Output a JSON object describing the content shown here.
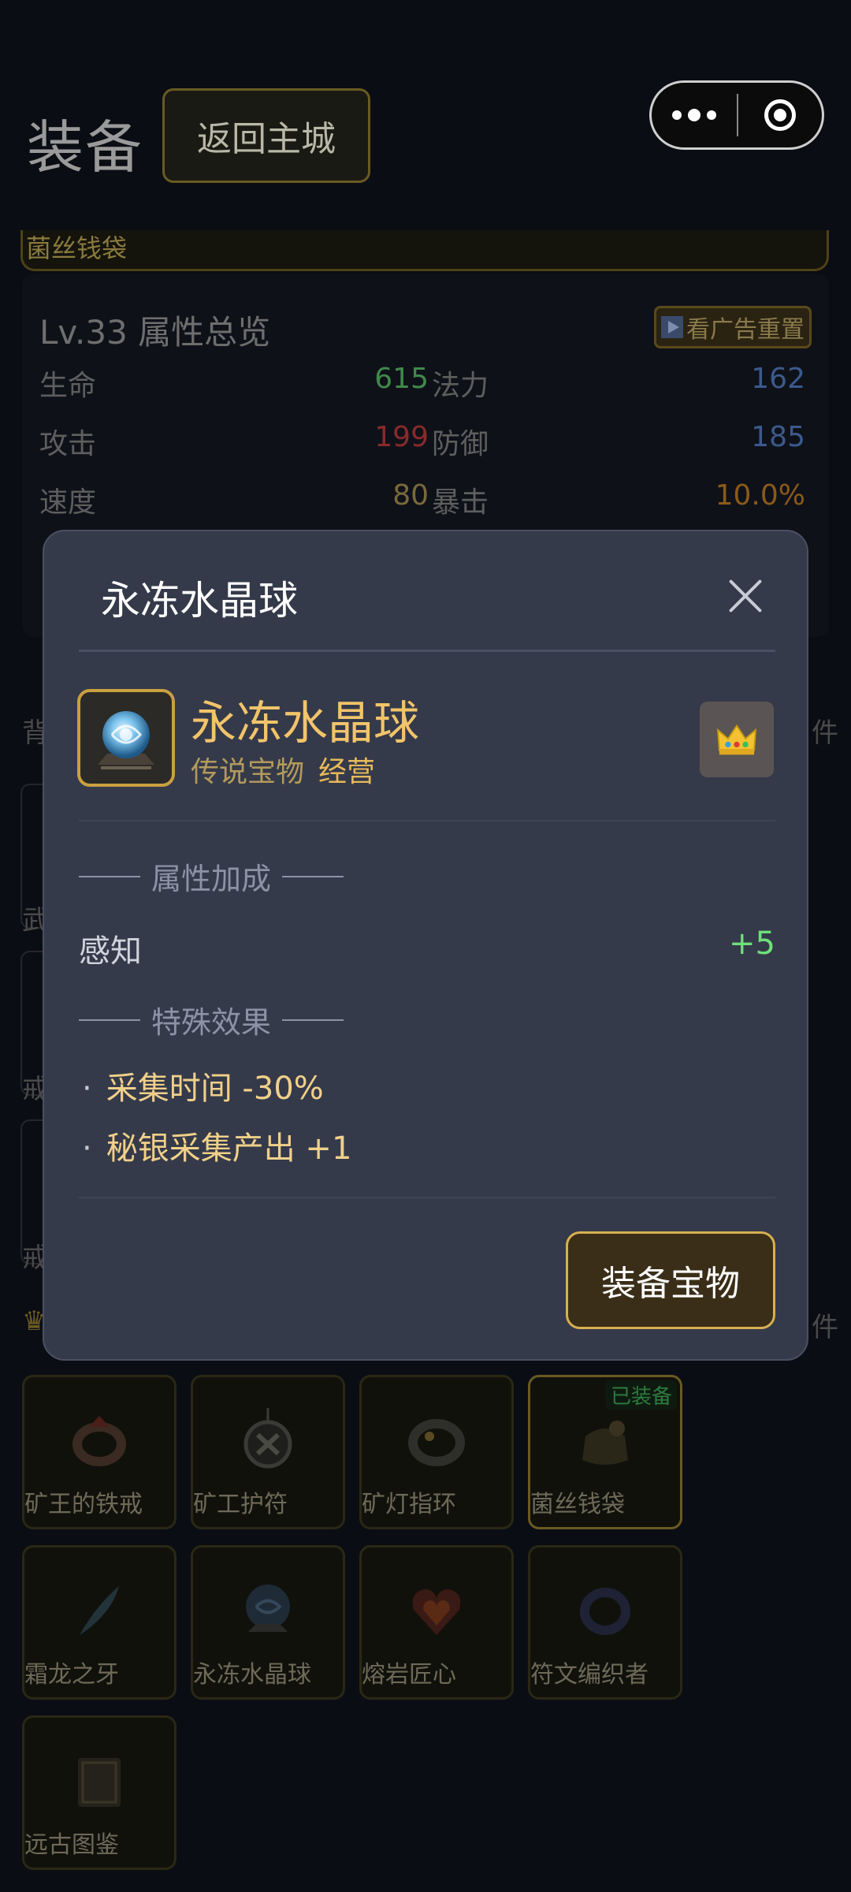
{
  "header": {
    "title": "装备",
    "back_label": "返回主城"
  },
  "bag_strip": {
    "label": "菌丝钱袋"
  },
  "stats": {
    "title": "Lv.33 属性总览",
    "ad_label": "看广告重置",
    "rows": [
      {
        "l1": "生命",
        "v1": "615",
        "l2": "法力",
        "v2": "162"
      },
      {
        "l1": "攻击",
        "v1": "199",
        "l2": "防御",
        "v2": "185"
      },
      {
        "l1": "速度",
        "v1": "80",
        "l2": "暴击",
        "v2": "10.0%"
      }
    ],
    "colors": {
      "hp": "#3f8a4a",
      "mp": "#3b5a8c",
      "atk": "#8a2a2a",
      "def": "#3b5a8c",
      "spd": "#7a6a3a",
      "crit": "#8a5a1a"
    }
  },
  "background": {
    "bag_label_partial": "背",
    "right_partial": "件",
    "side_labels": [
      "武",
      "戒",
      "戒"
    ]
  },
  "grid": {
    "equipped_badge": "已装备",
    "items": [
      {
        "name": "矿王的铁戒",
        "icon": "iron-ring-icon"
      },
      {
        "name": "矿工护符",
        "icon": "amulet-icon"
      },
      {
        "name": "矿灯指环",
        "icon": "lamp-ring-icon"
      },
      {
        "name": "菌丝钱袋",
        "icon": "pouch-icon",
        "equipped": true
      },
      {
        "name": "霜龙之牙",
        "icon": "fang-icon"
      },
      {
        "name": "永冻水晶球",
        "icon": "crystal-ball-icon"
      },
      {
        "name": "熔岩匠心",
        "icon": "lava-heart-icon"
      },
      {
        "name": "符文编织者",
        "icon": "rune-bracelet-icon"
      },
      {
        "name": "远古图鉴",
        "icon": "ancient-book-icon"
      }
    ]
  },
  "modal": {
    "title": "永冻水晶球",
    "item_name": "永冻水晶球",
    "rarity": "传说宝物",
    "category": "经营",
    "attr_section": "属性加成",
    "attrs": [
      {
        "name": "感知",
        "value": "+5"
      }
    ],
    "effect_section": "特殊效果",
    "effects": [
      "采集时间 -30%",
      "秘银采集产出 +1"
    ],
    "equip_label": "装备宝物",
    "crown_icon": "crown-icon",
    "close_icon": "close-icon"
  }
}
